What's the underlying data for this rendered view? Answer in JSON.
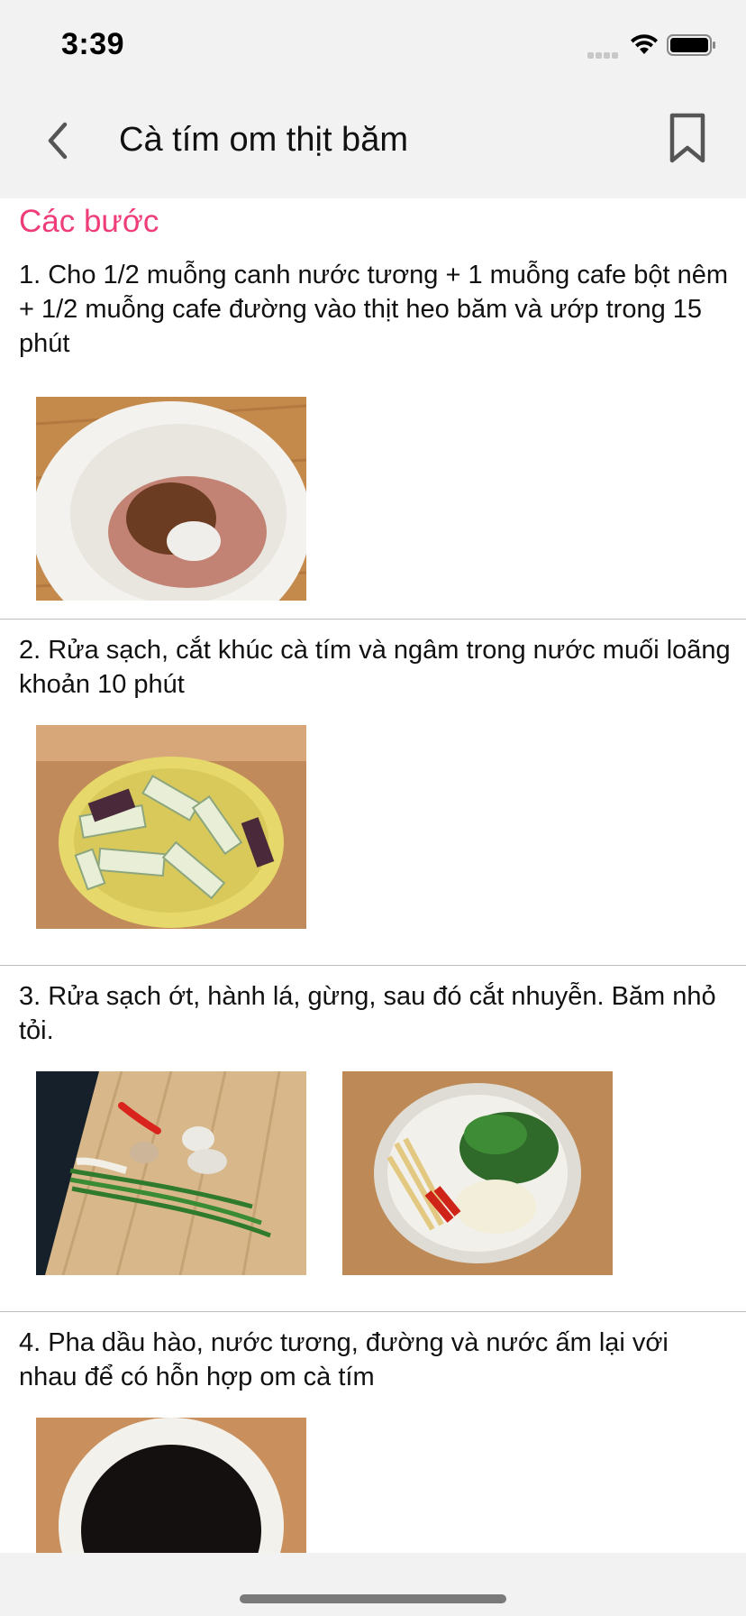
{
  "status_bar": {
    "time": "3:39",
    "icons": [
      "cellular-signal-icon",
      "wifi-icon",
      "battery-icon"
    ]
  },
  "nav": {
    "back_icon": "chevron-left-icon",
    "title": "Cà tím om thịt băm",
    "bookmark_icon": "bookmark-icon"
  },
  "section_title": "Các bước",
  "colors": {
    "accent": "#ee3d7a",
    "chrome_background": "#f2f2f2",
    "divider": "#bdbdbd"
  },
  "steps": [
    {
      "text": "1. Cho 1/2 muỗng canh nước tương + 1 muỗng cafe bột nêm + 1/2 muỗng cafe đường vào thịt heo băm và ướp trong 15 phút",
      "images": [
        "ground-pork-in-bowl-photo"
      ]
    },
    {
      "text": "2. Rửa sạch, cắt khúc cà tím và ngâm trong nước muối loãng khoản 10 phút",
      "images": [
        "eggplant-in-bowl-photo"
      ]
    },
    {
      "text": "3. Rửa sạch ớt, hành lá, gừng, sau đó cắt nhuyễn. Băm nhỏ tỏi.",
      "images": [
        "chili-scallion-garlic-board-photo",
        "chopped-aromatics-plate-photo"
      ]
    },
    {
      "text": "4. Pha dầu hào, nước tương, đường và nước ấm lại với nhau để có hỗn hợp om cà tím",
      "images": [
        "sauce-bowl-photo"
      ]
    }
  ]
}
